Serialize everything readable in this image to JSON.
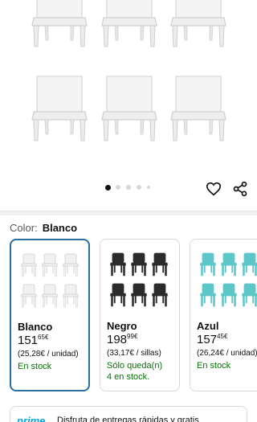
{
  "gallery": {
    "dot_count": 5,
    "active_index": 0,
    "heart_icon": "heart-icon",
    "share_icon": "share-icon"
  },
  "color_selector": {
    "label": "Color:",
    "selected": "Blanco"
  },
  "variants": [
    {
      "name": "Blanco",
      "price_whole": "151",
      "price_fraction": "65",
      "currency": "€",
      "unit_price": "(25,28€ / unidad)",
      "stock_line1": "En stock",
      "stock_line2": "",
      "chair_color": "#f1f1f1"
    },
    {
      "name": "Negro",
      "price_whole": "198",
      "price_fraction": "99",
      "currency": "€",
      "unit_price": "(33,17€ / sillas)",
      "stock_line1": "Sólo queda(n)",
      "stock_line2": "4 en stock.",
      "chair_color": "#2b2b2b"
    },
    {
      "name": "Azul",
      "price_whole": "157",
      "price_fraction": "45",
      "currency": "€",
      "unit_price": "(26,24€ / unidad)",
      "stock_line1": "En stock",
      "stock_line2": "",
      "chair_color": "#5cc6c9"
    }
  ],
  "prime_banner": {
    "logo": "prime",
    "text": "Disfruta de entregas rápidas y gratis"
  },
  "colors": {
    "selected_border": "#2a6f9e",
    "in_stock": "#007600",
    "prime_blue": "#00a8e1"
  }
}
